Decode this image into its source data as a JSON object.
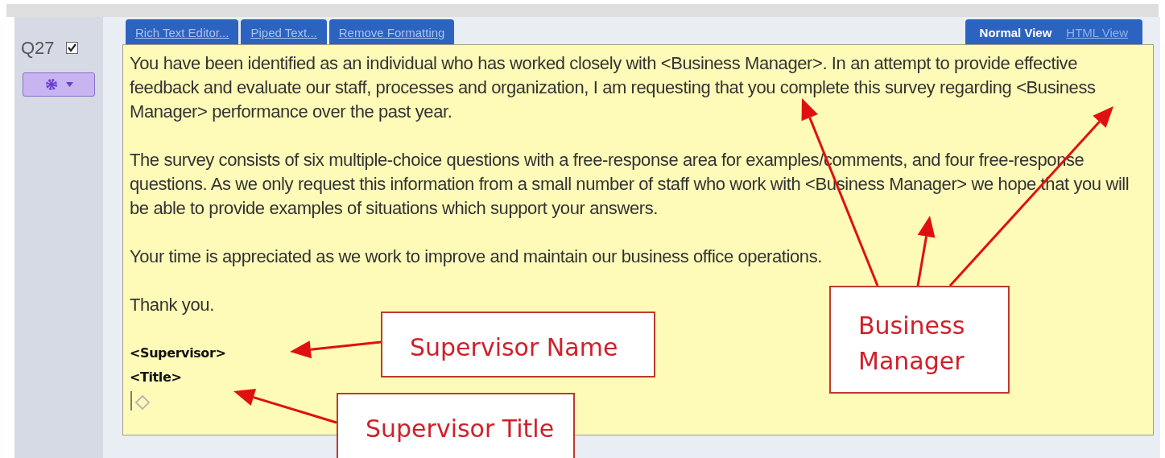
{
  "question": {
    "number": "Q27",
    "checked": true
  },
  "toolbar_tabs": [
    {
      "label": "Rich Text Editor..."
    },
    {
      "label": "Piped Text..."
    },
    {
      "label": "Remove Formatting"
    }
  ],
  "view_tabs": [
    {
      "label": "Normal View",
      "selected": true
    },
    {
      "label": "HTML View",
      "selected": false
    }
  ],
  "editor": {
    "paragraphs": [
      {
        "kind": "plain",
        "text": "You have been identified as an individual who has worked closely with <Business Manager>.  In an attempt to provide effective feedback and evaluate our staff, processes and organization, I am requesting that you complete this survey regarding <Business Manager> performance over the past year."
      },
      {
        "kind": "plain",
        "text": "The survey consists of six multiple-choice questions with a free-response area for examples/comments, and four free-response questions. As we only request this information from a small number of staff who work with <Business Manager> we hope that you will be able to provide examples of situations which support your answers."
      },
      {
        "kind": "plain",
        "text": "Your time is appreciated as we work to improve and maintain our business office operations."
      },
      {
        "kind": "plain",
        "text": "Thank you."
      },
      {
        "kind": "signature",
        "lines": [
          "<Supervisor>",
          "<Title>"
        ]
      }
    ]
  },
  "annotations": [
    {
      "label": "Supervisor Name"
    },
    {
      "label": "Business Manager"
    },
    {
      "label": "Supervisor Title"
    }
  ]
}
